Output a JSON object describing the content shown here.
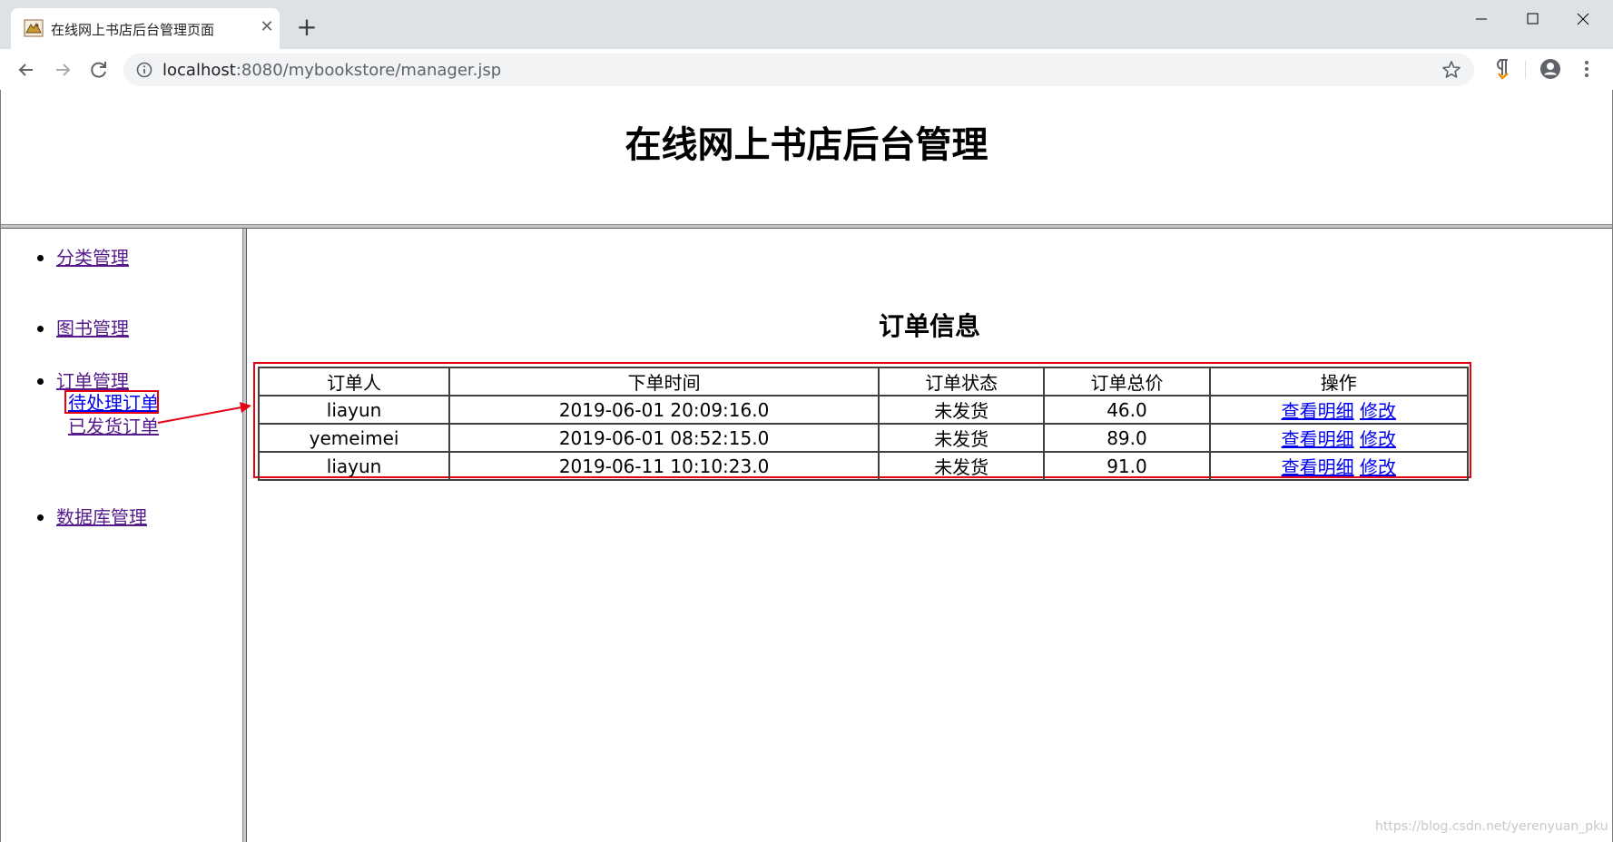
{
  "browser": {
    "tab_title": "在线网上书店后台管理页面",
    "url_host": "localhost",
    "url_path": ":8080/mybookstore/manager.jsp"
  },
  "header": {
    "title": "在线网上书店后台管理"
  },
  "sidebar": {
    "items": [
      {
        "label": "分类管理"
      },
      {
        "label": "图书管理"
      },
      {
        "label": "订单管理"
      },
      {
        "label": "数据库管理"
      }
    ],
    "order_subitems": [
      {
        "label": "待处理订单"
      },
      {
        "label": "已发货订单"
      }
    ]
  },
  "main": {
    "heading": "订单信息",
    "table": {
      "columns": [
        "订单人",
        "下单时间",
        "订单状态",
        "订单总价",
        "操作"
      ],
      "rows": [
        {
          "person": "liayun",
          "time": "2019-06-01 20:09:16.0",
          "status": "未发货",
          "total": "46.0",
          "detail": "查看明细",
          "edit": "修改"
        },
        {
          "person": "yemeimei",
          "time": "2019-06-01 08:52:15.0",
          "status": "未发货",
          "total": "89.0",
          "detail": "查看明细",
          "edit": "修改"
        },
        {
          "person": "liayun",
          "time": "2019-06-11 10:10:23.0",
          "status": "未发货",
          "total": "91.0",
          "detail": "查看明细",
          "edit": "修改"
        }
      ]
    }
  },
  "watermark": "https://blog.csdn.net/yerenyuan_pku",
  "colors": {
    "annotation": "#e60012",
    "link": "#0000ee",
    "visited_link": "#551a8b"
  }
}
